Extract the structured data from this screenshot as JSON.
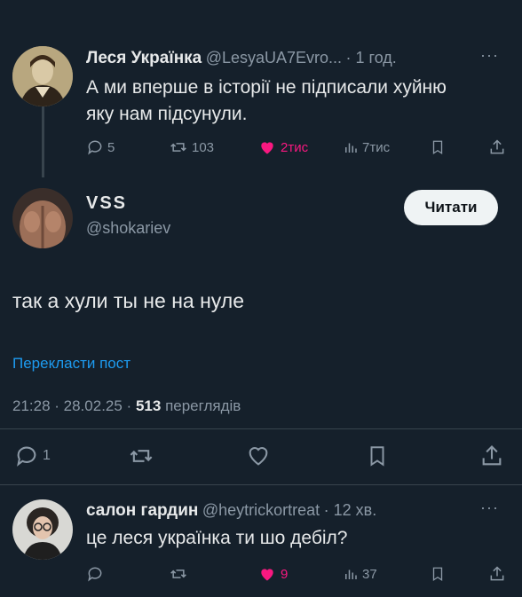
{
  "quoted_tweet": {
    "name": "Леся Українка",
    "handle": "@LesyaUA7Evro...",
    "time": "· 1 год.",
    "more": "···",
    "text_line1": "А ми вперше в історії не підписали хуйню",
    "text_line2": "яку нам підсунули.",
    "replies": "5",
    "retweets": "103",
    "likes": "2тис",
    "views": "7тис"
  },
  "main_tweet": {
    "name": "VSS",
    "handle": "@shokariev",
    "follow_label": "Читати",
    "text": "так а хули ты не на нуле",
    "translate_label": "Перекласти пост",
    "timestamp": "21:28 · 28.02.25 ·",
    "views_count": "513",
    "views_label": "переглядів",
    "replies": "1"
  },
  "reply_tweet": {
    "name": "салон гардин",
    "handle": "@heytrickortreat",
    "time": "· 12 хв.",
    "more": "···",
    "text": "це леся українка ти шо дебіл?",
    "likes": "9",
    "views": "37"
  },
  "colors": {
    "background": "#15202b",
    "accent_blue": "#1d9bf0",
    "like_pink": "#f91880",
    "muted": "#8b98a5"
  }
}
